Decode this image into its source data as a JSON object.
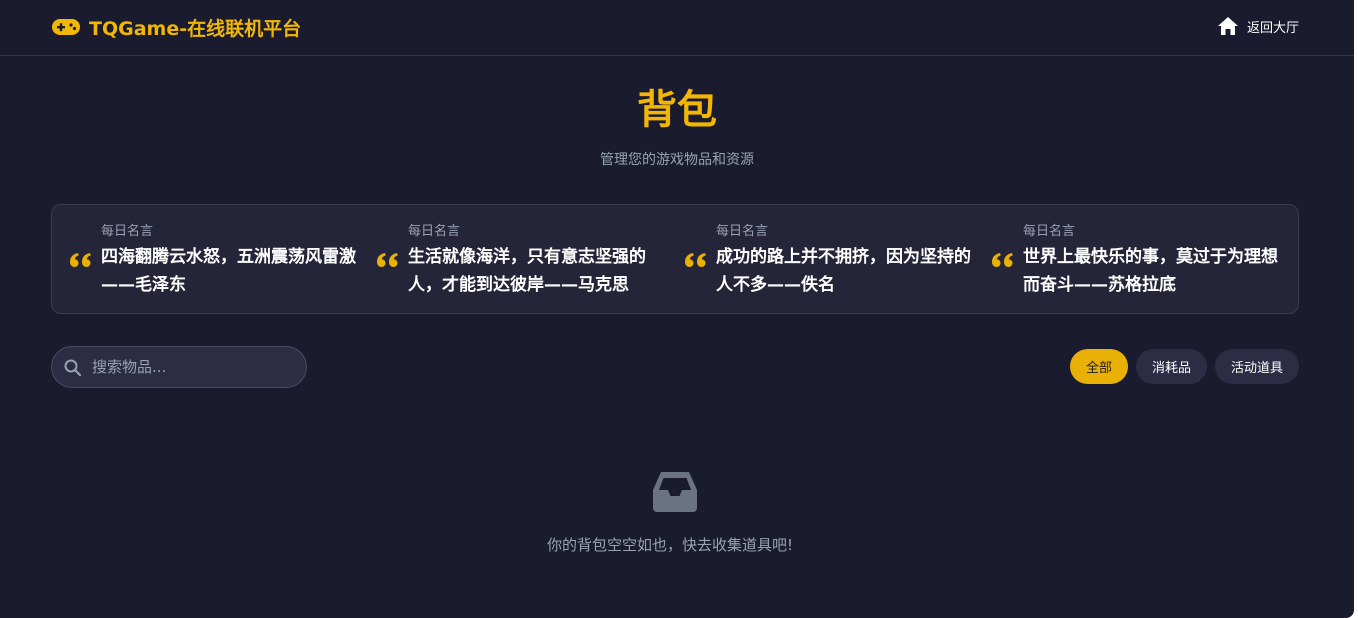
{
  "header": {
    "brand": "TQGame-在线联机平台",
    "back_label": "返回大厅"
  },
  "page": {
    "title": "背包",
    "subtitle": "管理您的游戏物品和资源"
  },
  "quotes": [
    {
      "label": "每日名言",
      "text": "四海翻腾云水怒，五洲震荡风雷激——毛泽东"
    },
    {
      "label": "每日名言",
      "text": "生活就像海洋，只有意志坚强的人，才能到达彼岸——马克思"
    },
    {
      "label": "每日名言",
      "text": "成功的路上并不拥挤，因为坚持的人不多——佚名"
    },
    {
      "label": "每日名言",
      "text": "世界上最快乐的事，莫过于为理想而奋斗——苏格拉底"
    }
  ],
  "search": {
    "placeholder": "搜索物品..."
  },
  "filters": [
    {
      "label": "全部",
      "active": true
    },
    {
      "label": "消耗品",
      "active": false
    },
    {
      "label": "活动道具",
      "active": false
    }
  ],
  "empty": {
    "message": "你的背包空空如也，快去收集道具吧!"
  },
  "icons": {
    "brand": "gamepad-icon",
    "back": "home-icon",
    "quote": "quote-icon",
    "search": "search-icon",
    "empty": "inbox-icon"
  },
  "colors": {
    "background": "#1a1b2e",
    "accent": "#f2b705",
    "card": "#242538",
    "muted": "#9aa0b4"
  }
}
